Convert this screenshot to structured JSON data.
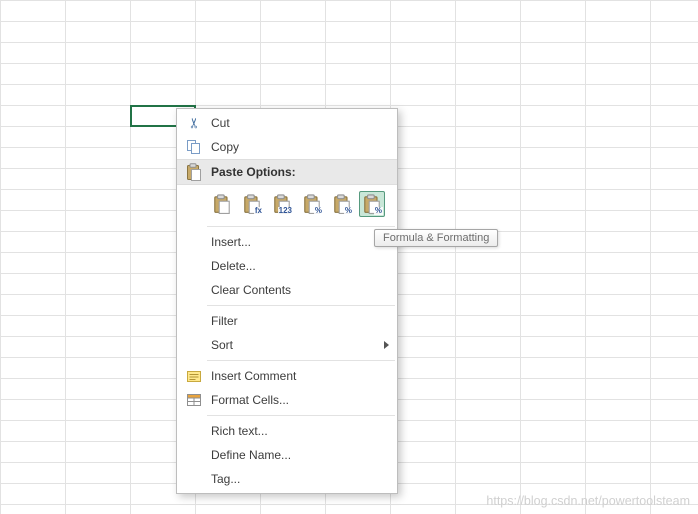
{
  "watermark": "https://blog.csdn.net/powertoolsteam",
  "tooltip": {
    "text": "Formula & Formatting"
  },
  "menu": {
    "cut": "Cut",
    "copy": "Copy",
    "paste_options_label": "Paste Options:",
    "paste_icons": [
      {
        "name": "paste",
        "glyph": ""
      },
      {
        "name": "paste-formulas",
        "glyph": "fx"
      },
      {
        "name": "paste-values",
        "glyph": "123"
      },
      {
        "name": "paste-formatting",
        "glyph": "%"
      },
      {
        "name": "paste-values-formatting",
        "glyph": "%"
      },
      {
        "name": "paste-formula-formatting",
        "glyph": "%"
      }
    ],
    "insert": "Insert...",
    "delete": "Delete...",
    "clear_contents": "Clear Contents",
    "filter": "Filter",
    "sort": "Sort",
    "insert_comment": "Insert Comment",
    "format_cells": "Format Cells...",
    "rich_text": "Rich text...",
    "define_name": "Define Name...",
    "tag": "Tag...",
    "colors": {
      "selection_border": "#217346",
      "selected_paste_bg": "#c9e7d8",
      "selected_paste_border": "#569a7e",
      "menu_header_bg": "#e9e9e9"
    }
  }
}
